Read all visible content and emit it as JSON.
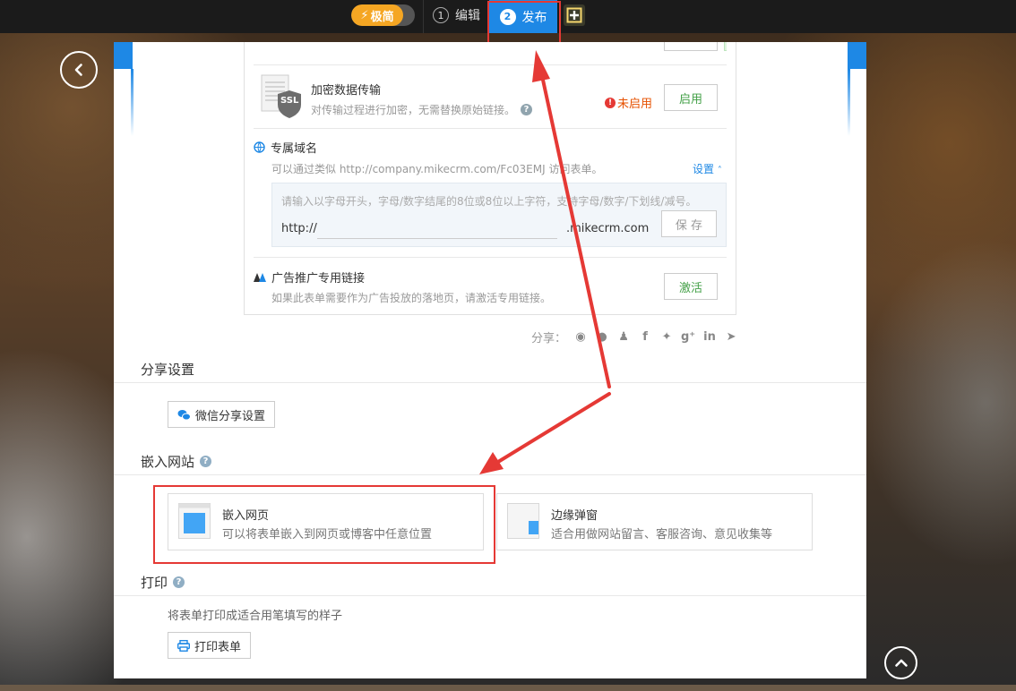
{
  "topbar": {
    "mode_label": "极简",
    "step1_num": "1",
    "step1_label": "编辑",
    "step2_num": "2",
    "step2_label": "发布"
  },
  "ssl": {
    "badge": "SSL",
    "title": "加密数据传输",
    "desc": "对传输过程进行加密，无需替换原始链接。",
    "status": "未启用",
    "enable_label": "启用"
  },
  "domain": {
    "title": "专属域名",
    "desc": "可以通过类似 http://company.mikecrm.com/Fc03EMJ 访问表单。",
    "settings_label": "设置",
    "hint": "请输入以字母开头，字母/数字结尾的8位或8位以上字符，支持字母/数字/下划线/减号。",
    "prefix": "http://",
    "input_value": "",
    "suffix": ".mikecrm.com",
    "save_label": "保 存"
  },
  "ad_link": {
    "title": "广告推广专用链接",
    "desc": "如果此表单需要作为广告投放的落地页，请激活专用链接。",
    "activate_label": "激活"
  },
  "share": {
    "label": "分享："
  },
  "share_settings": {
    "title": "分享设置",
    "wechat_button": "微信分享设置"
  },
  "embed": {
    "title": "嵌入网站",
    "options": [
      {
        "title": "嵌入网页",
        "desc": "可以将表单嵌入到网页或博客中任意位置"
      },
      {
        "title": "边缘弹窗",
        "desc": "适合用做网站留言、客服咨询、意见收集等"
      }
    ]
  },
  "print": {
    "title": "打印",
    "desc": "将表单打印成适合用笔填写的样子",
    "button": "打印表单"
  },
  "colors": {
    "accent": "#1e88e5",
    "highlight": "#e53935",
    "mode": "#f5a623",
    "success": "#43a047",
    "warning": "#e65100"
  }
}
